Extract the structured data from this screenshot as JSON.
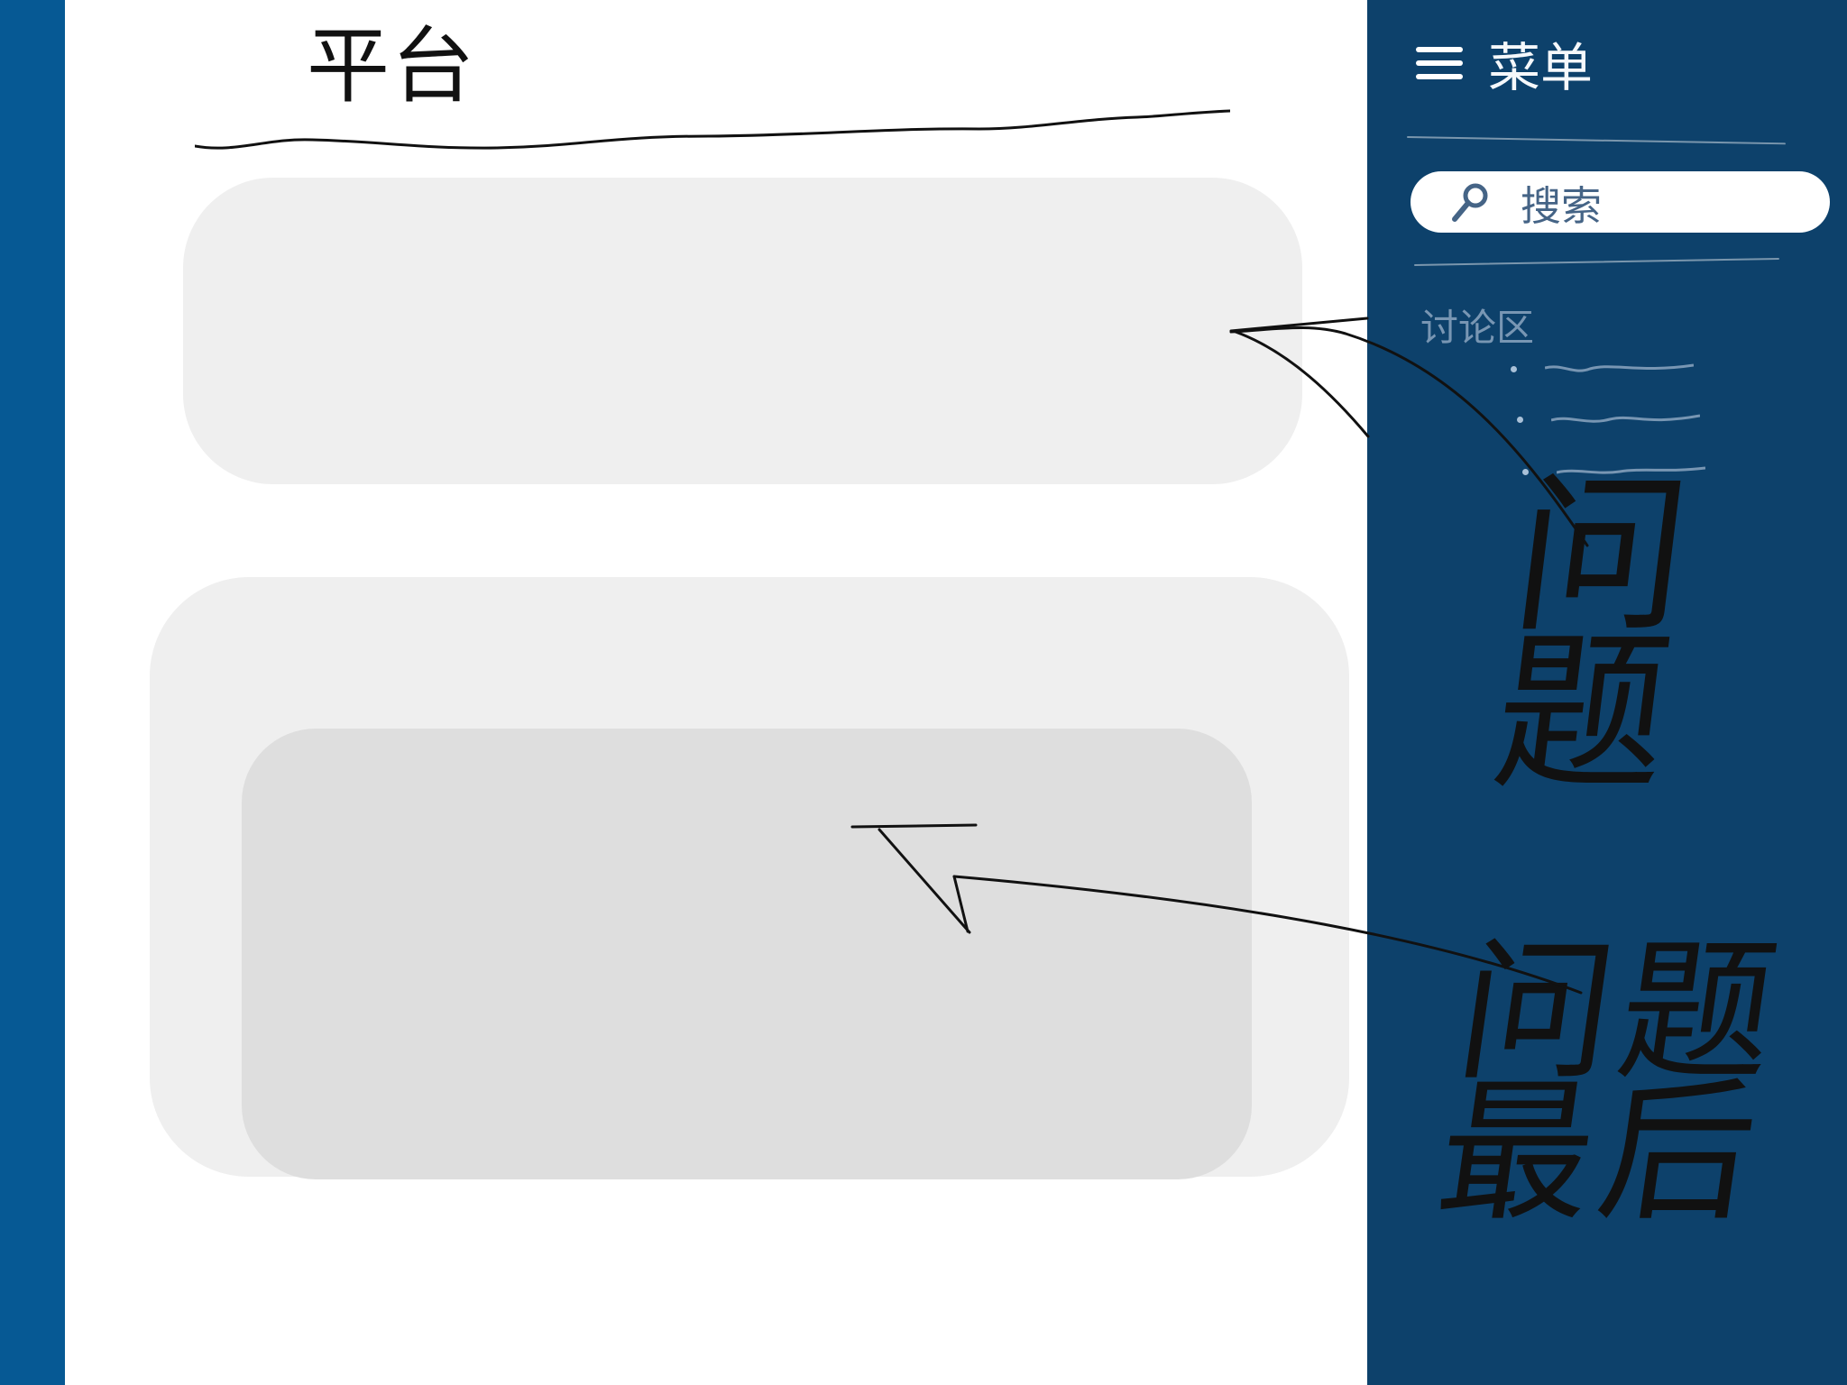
{
  "title": "平台",
  "sidebar": {
    "menu_label": "菜单",
    "search_placeholder": "搜索",
    "recent_label": "讨论区"
  },
  "annotations": {
    "upper": "问题",
    "lower": "问题\n最后"
  },
  "colors": {
    "left_bar": "#065994",
    "sidebar": "#0d416b",
    "placeholder": "#efefef",
    "inner_placeholder": "#dedede"
  }
}
